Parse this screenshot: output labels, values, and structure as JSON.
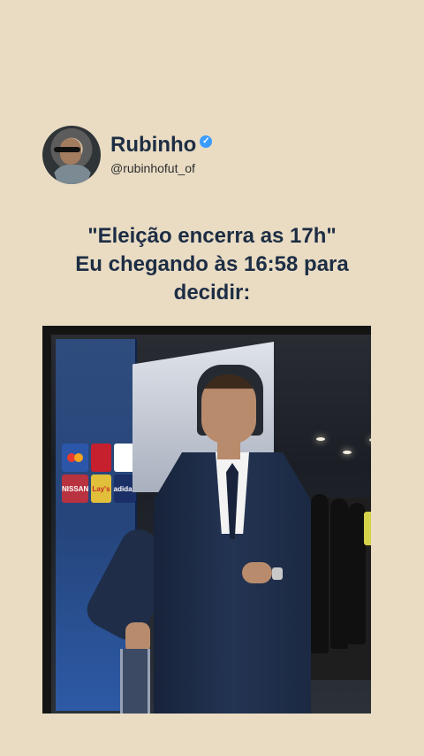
{
  "profile": {
    "name": "Rubinho",
    "handle": "@rubinhofut_of",
    "verified_icon": "verified-icon"
  },
  "caption": {
    "line1": "\"Eleição encerra as 17h\"",
    "line2": "Eu chegando às 16:58 para",
    "line3": "decidir:"
  },
  "image": {
    "logos": [
      "",
      "",
      "",
      "NISSAN",
      "Lay's",
      "adidas"
    ]
  },
  "colors": {
    "background": "#e9dcc3",
    "text": "#1d2d44",
    "handle": "#2e2e2e",
    "verified": "#3b9cff"
  }
}
